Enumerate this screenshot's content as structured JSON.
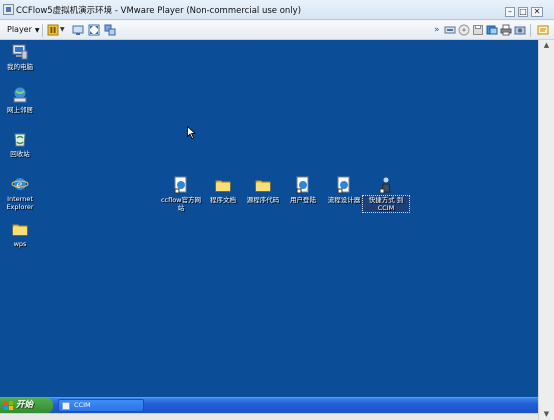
{
  "window": {
    "title": "CCFlow5虚拟机演示环境 - VMware Player (Non-commercial use only)",
    "minimize_glyph": "–",
    "maximize_glyph": "□",
    "close_glyph": "✕"
  },
  "toolbar": {
    "player_label": "Player",
    "player_arrow": "▼"
  },
  "desktop": {
    "background_color": "#0c4d98",
    "icons": [
      {
        "label": "我的电脑",
        "icon": "computer-icon"
      },
      {
        "label": "网上邻居",
        "icon": "network-icon"
      },
      {
        "label": "回收站",
        "icon": "recycle-bin-icon"
      },
      {
        "label": "Internet Explorer",
        "icon": "ie-icon"
      },
      {
        "label": "wps",
        "icon": "folder-icon"
      },
      {
        "label": "ccflow官方网站",
        "icon": "web-shortcut-icon"
      },
      {
        "label": "程序文档",
        "icon": "folder-icon"
      },
      {
        "label": "源程序代码",
        "icon": "folder-icon"
      },
      {
        "label": "用户登陆",
        "icon": "web-shortcut-icon"
      },
      {
        "label": "流程设计器",
        "icon": "web-shortcut-icon"
      },
      {
        "label": "快捷方式 到 CCIM",
        "icon": "ccim-shortcut-icon"
      }
    ]
  },
  "taskbar": {
    "start_label": "开始",
    "tasks": [
      {
        "label": "CCIM"
      }
    ]
  },
  "scroll": {
    "up_glyph": "▲",
    "down_glyph": "▼"
  }
}
